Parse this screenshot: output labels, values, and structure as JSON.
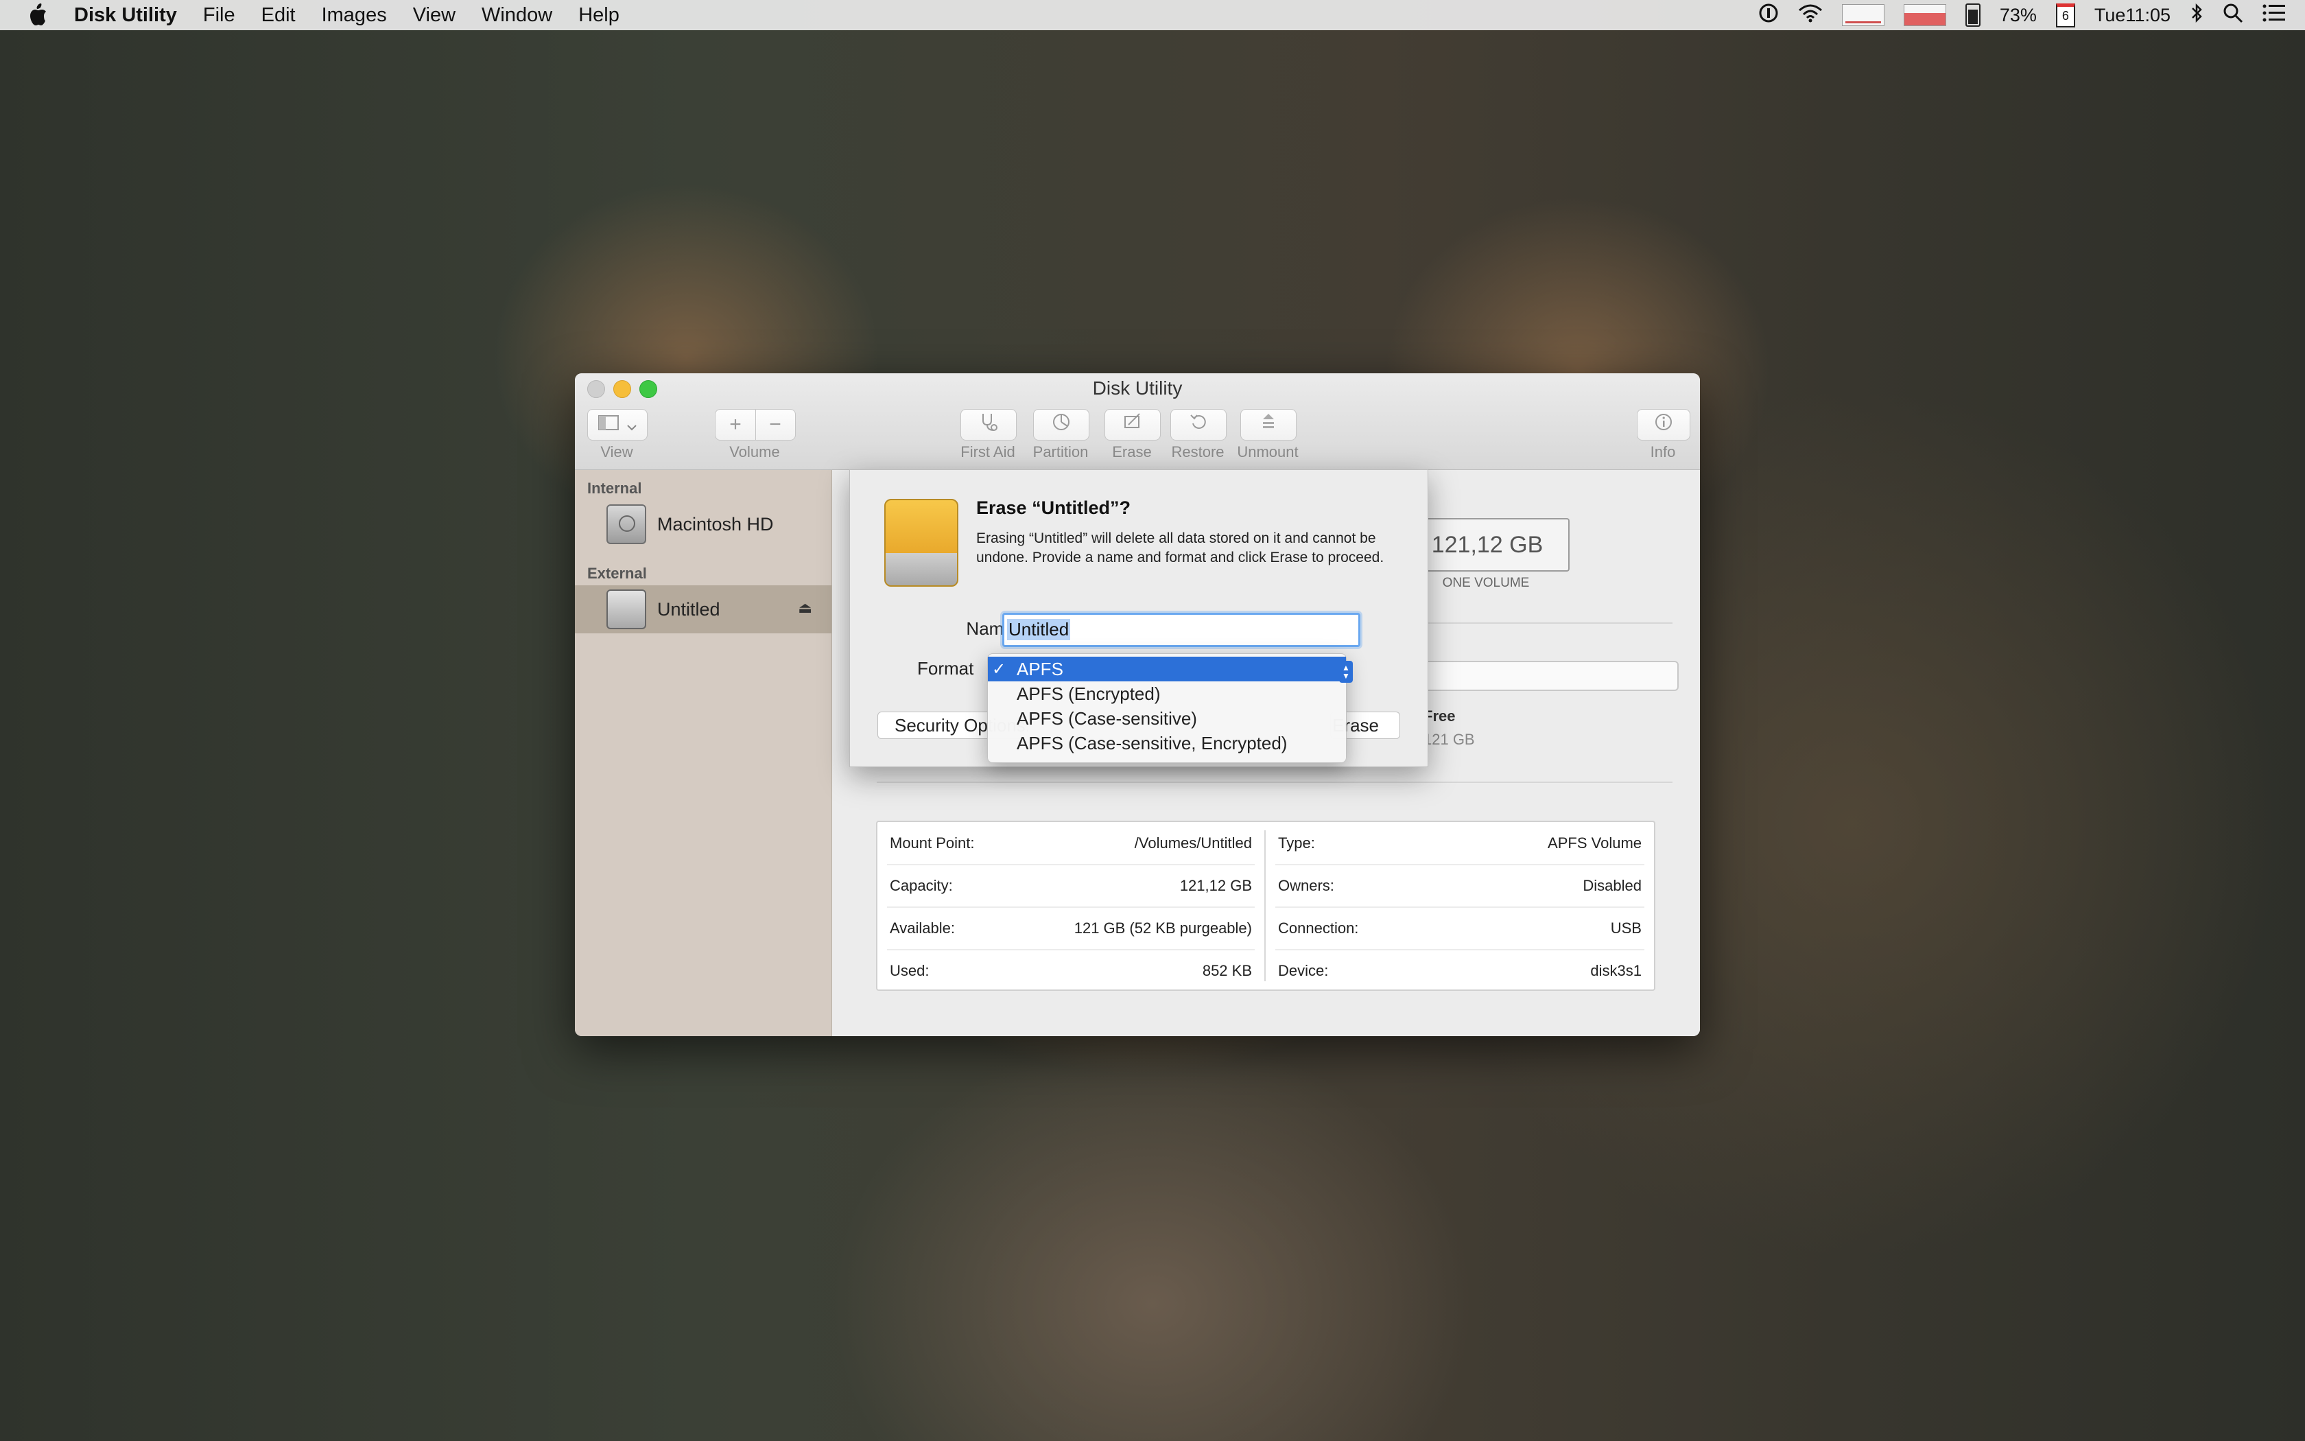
{
  "menubar": {
    "app_name": "Disk Utility",
    "menus": [
      "File",
      "Edit",
      "Images",
      "View",
      "Window",
      "Help"
    ],
    "battery_percent": "73%",
    "calendar_day": "6",
    "clock": "Tue11:05"
  },
  "window": {
    "title": "Disk Utility",
    "toolbar": {
      "view_label": "View",
      "volume_label": "Volume",
      "first_aid_label": "First Aid",
      "partition_label": "Partition",
      "erase_label": "Erase",
      "restore_label": "Restore",
      "unmount_label": "Unmount",
      "info_label": "Info"
    }
  },
  "sidebar": {
    "internal_header": "Internal",
    "external_header": "External",
    "items": [
      {
        "label": "Macintosh HD"
      },
      {
        "label": "Untitled"
      }
    ]
  },
  "main": {
    "capacity": "121,12 GB",
    "volume_count": "ONE VOLUME",
    "free_label": "Free",
    "free_value": "121 GB",
    "info": {
      "left": [
        {
          "key": "Mount Point:",
          "value": "/Volumes/Untitled"
        },
        {
          "key": "Capacity:",
          "value": "121,12 GB"
        },
        {
          "key": "Available:",
          "value": "121 GB (52 KB purgeable)"
        },
        {
          "key": "Used:",
          "value": "852 KB"
        }
      ],
      "right": [
        {
          "key": "Type:",
          "value": "APFS Volume"
        },
        {
          "key": "Owners:",
          "value": "Disabled"
        },
        {
          "key": "Connection:",
          "value": "USB"
        },
        {
          "key": "Device:",
          "value": "disk3s1"
        }
      ]
    }
  },
  "erase_sheet": {
    "title": "Erase “Untitled”?",
    "description": "Erasing “Untitled” will delete all data stored on it and cannot be undone. Provide a name and format and click Erase to proceed.",
    "name_label": "Name:",
    "name_value": "Untitled",
    "format_label": "Format",
    "security_button": "Security Options...",
    "erase_button": "Erase",
    "format_options": [
      "APFS",
      "APFS (Encrypted)",
      "APFS (Case-sensitive)",
      "APFS (Case-sensitive, Encrypted)"
    ],
    "selected_check": "✓"
  }
}
